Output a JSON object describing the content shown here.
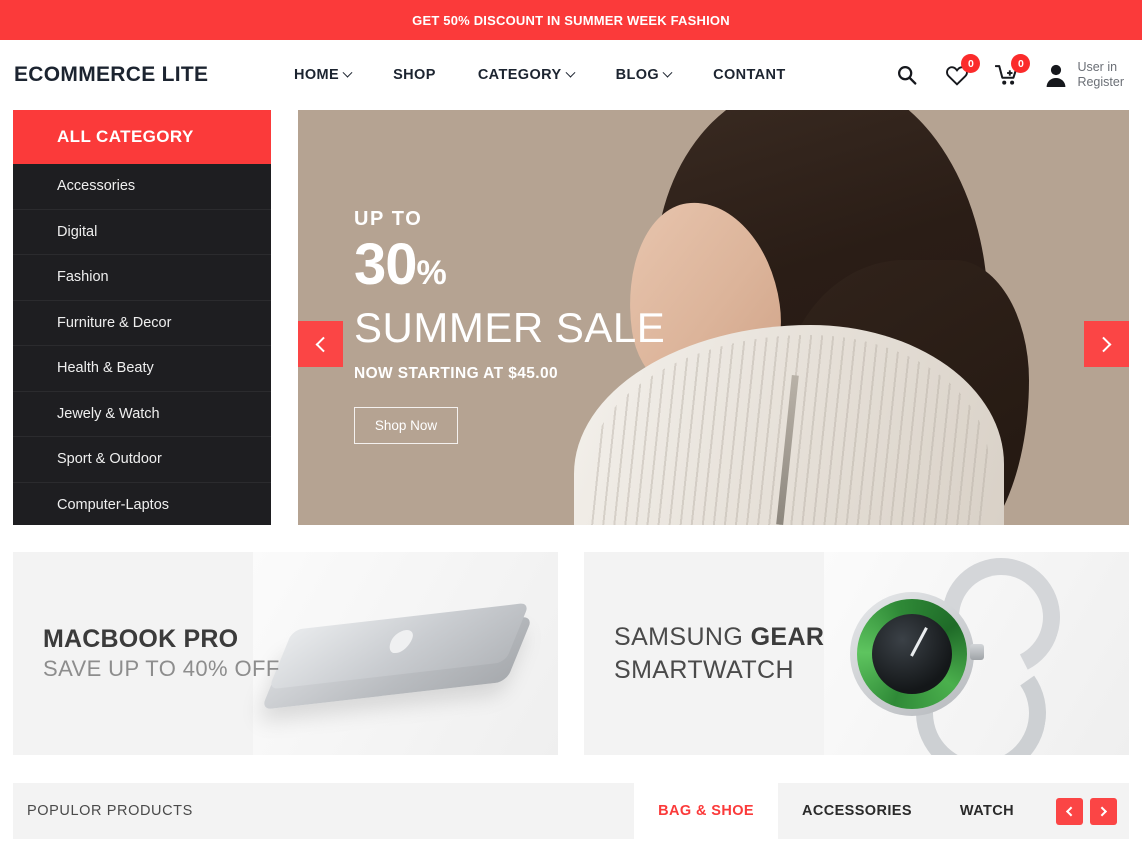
{
  "announcement": {
    "text": "GET 50% DISCOUNT IN SUMMER WEEK FASHION",
    "bg_color": "#FB3A3A"
  },
  "header": {
    "logo": "ECOMMERCE LITE",
    "nav": [
      {
        "label": "HOME",
        "has_dropdown": true
      },
      {
        "label": "SHOP",
        "has_dropdown": false
      },
      {
        "label": "CATEGORY",
        "has_dropdown": true
      },
      {
        "label": "BLOG",
        "has_dropdown": true
      },
      {
        "label": "CONTANT",
        "has_dropdown": false
      }
    ],
    "actions": {
      "search_icon": "search-icon",
      "wishlist_icon": "heart-icon",
      "wishlist_count": "0",
      "cart_icon": "cart-icon",
      "cart_count": "0",
      "user_icon": "user-icon",
      "user_line1": "User in",
      "user_line2": "Register"
    }
  },
  "sidebar": {
    "heading": "ALL CATEGORY",
    "heading_bg": "#FB3A3A",
    "bg_color": "#1E1E21",
    "items": [
      {
        "label": "Accessories"
      },
      {
        "label": "Digital"
      },
      {
        "label": "Fashion"
      },
      {
        "label": "Furniture & Decor"
      },
      {
        "label": "Health & Beaty"
      },
      {
        "label": "Jewely & Watch"
      },
      {
        "label": "Sport & Outdoor"
      },
      {
        "label": "Computer-Laptos"
      }
    ]
  },
  "hero": {
    "bg_color": "#B5A392",
    "up_to": "UP TO",
    "percent_value": "30",
    "percent_symbol": "%",
    "headline": "SUMMER SALE",
    "subline": "NOW STARTING AT $45.00",
    "button": "Shop Now",
    "prev_icon": "chevron-left-icon",
    "next_icon": "chevron-right-icon",
    "arrow_color": "#FB4545"
  },
  "promos": [
    {
      "title": "MACBOOK PRO",
      "subtitle": "SAVE UP TO 40% OFF",
      "image": "macbook-pro-image"
    },
    {
      "title_light": "SAMSUNG ",
      "title_bold": "GEAR",
      "subtitle": "SMARTWATCH",
      "image": "smartwatch-image"
    }
  ],
  "products_bar": {
    "title": "POPULOR PRODUCTS",
    "tabs": [
      {
        "label": "BAG & SHOE",
        "active": true
      },
      {
        "label": "ACCESSORIES",
        "active": false
      },
      {
        "label": "WATCH",
        "active": false
      }
    ],
    "prev_icon": "chevron-left-icon",
    "next_icon": "chevron-right-icon",
    "accent_color": "#FB4545"
  }
}
